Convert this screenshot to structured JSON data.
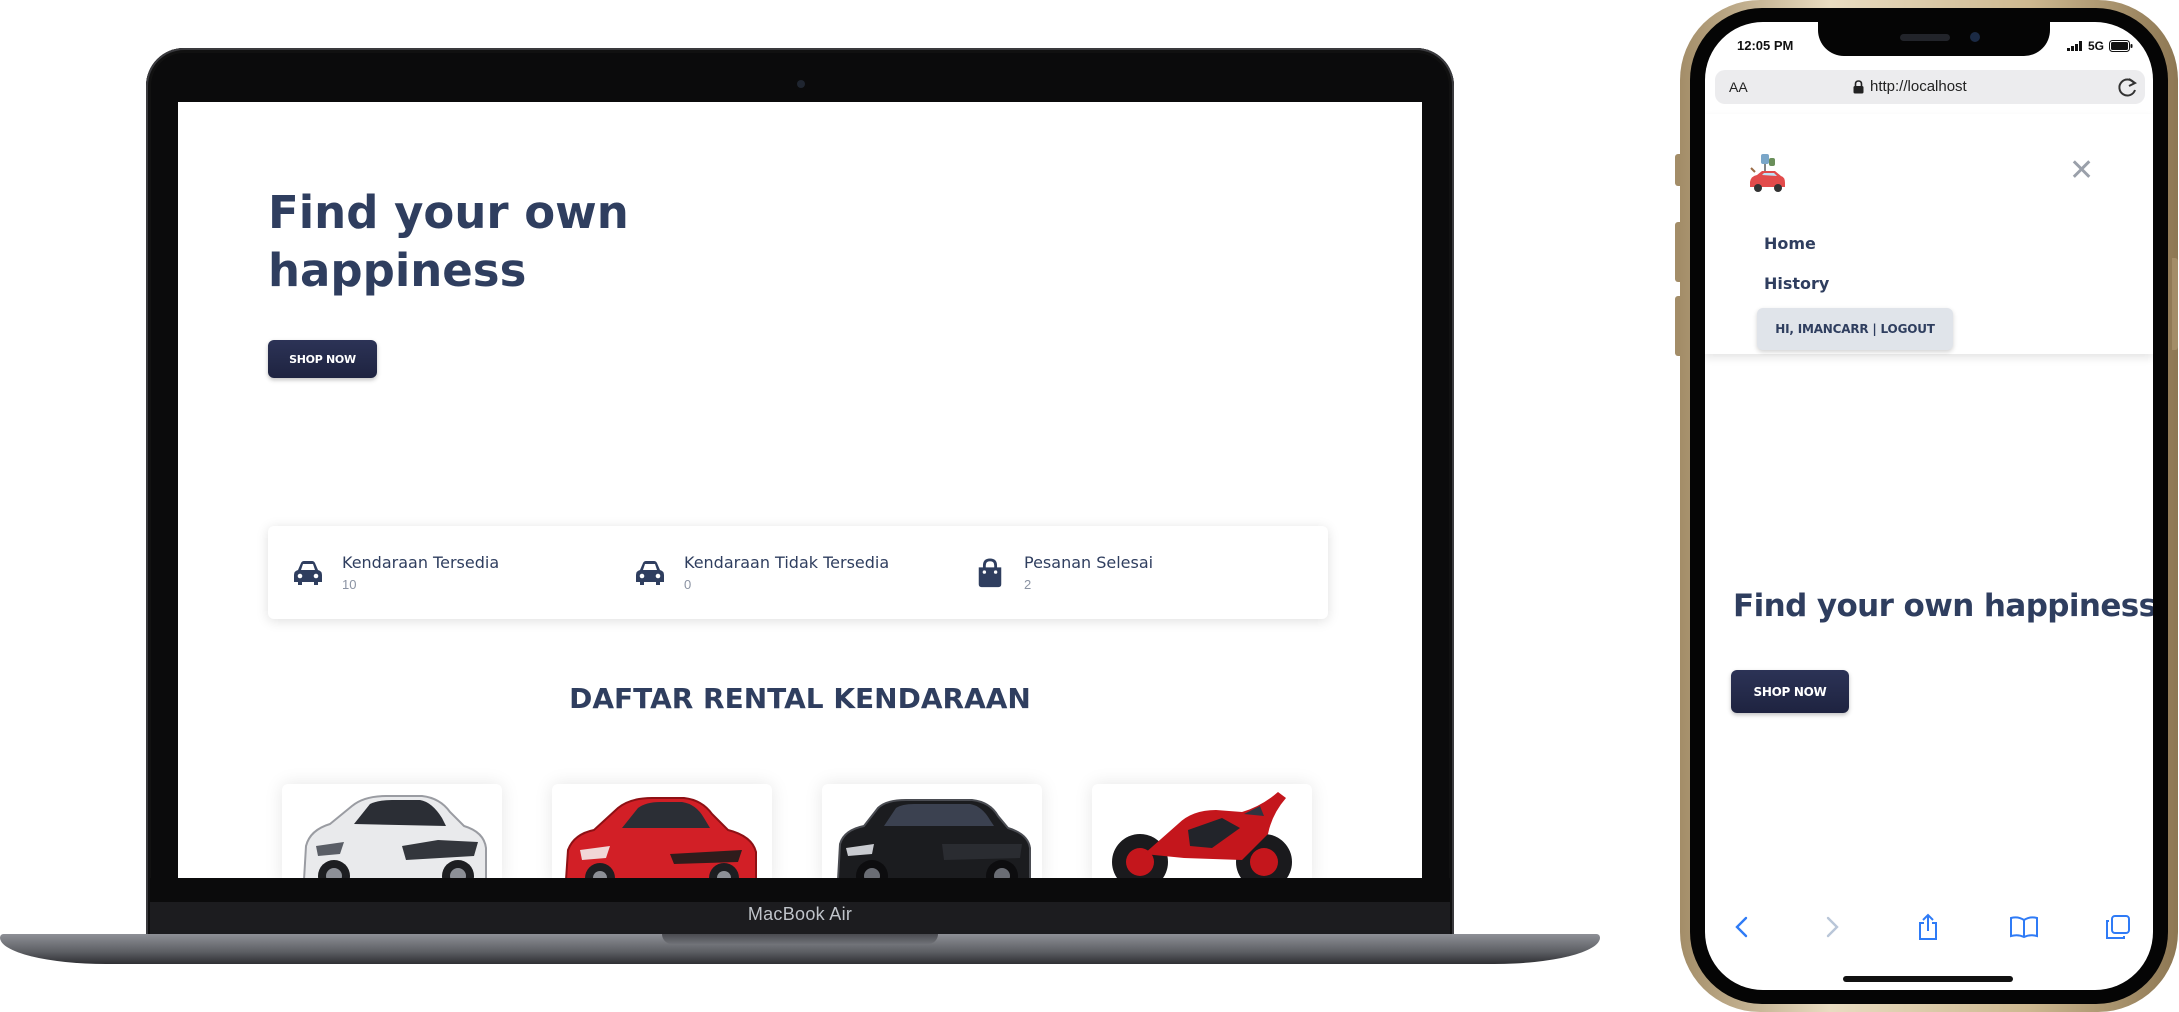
{
  "desktop": {
    "device_label": "MacBook Air",
    "hero": {
      "line1": "Find your own",
      "line2": "happiness"
    },
    "shop_button": "SHOP NOW",
    "stats": [
      {
        "icon": "car-icon",
        "label": "Kendaraan Tersedia",
        "value": "10"
      },
      {
        "icon": "car-icon",
        "label": "Kendaraan Tidak Tersedia",
        "value": "0"
      },
      {
        "icon": "shopping-bag-icon",
        "label": "Pesanan Selesai",
        "value": "2"
      }
    ],
    "section_title": "DAFTAR RENTAL KENDARAAN",
    "vehicles": [
      {
        "kind": "car",
        "color": "#e9eaec"
      },
      {
        "kind": "car",
        "color": "#d21f26"
      },
      {
        "kind": "suv",
        "color": "#1b1c1f"
      },
      {
        "kind": "motorcycle",
        "color": "#c4161c"
      }
    ]
  },
  "mobile": {
    "status_bar": {
      "time": "12:05 PM",
      "network": "5G"
    },
    "browser": {
      "text_size": "AA",
      "url": "http://localhost"
    },
    "nav": {
      "links": [
        "Home",
        "History"
      ],
      "account_button": "HI, IMANCARR | LOGOUT"
    },
    "hero": "Find your own happiness",
    "shop_button": "SHOP NOW",
    "toolbar": [
      "back-icon",
      "forward-icon",
      "share-icon",
      "bookmarks-icon",
      "tabs-icon"
    ]
  },
  "colors": {
    "primary_text": "#2f3e5f",
    "button_bg": "#262c4b",
    "muted_text": "#8b93a3"
  }
}
